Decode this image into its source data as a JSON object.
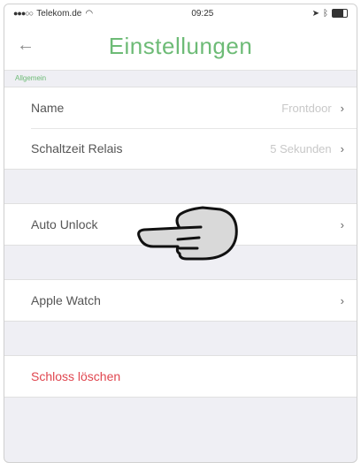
{
  "statusbar": {
    "carrier": "Telekom.de",
    "time": "09:25"
  },
  "header": {
    "back_icon": "arrow-left-icon",
    "title": "Einstellungen"
  },
  "section": {
    "title": "Allgemein"
  },
  "settings": {
    "name": {
      "label": "Name",
      "value": "Frontdoor"
    },
    "relay": {
      "label": "Schaltzeit Relais",
      "value": "5 Sekunden"
    },
    "auto_unlock": {
      "label": "Auto Unlock"
    },
    "apple_watch": {
      "label": "Apple Watch"
    },
    "delete_lock": {
      "label": "Schloss löschen"
    }
  },
  "chevron": "›",
  "colors": {
    "accent": "#6dbb76",
    "danger": "#e0464f",
    "background": "#efeff4"
  }
}
